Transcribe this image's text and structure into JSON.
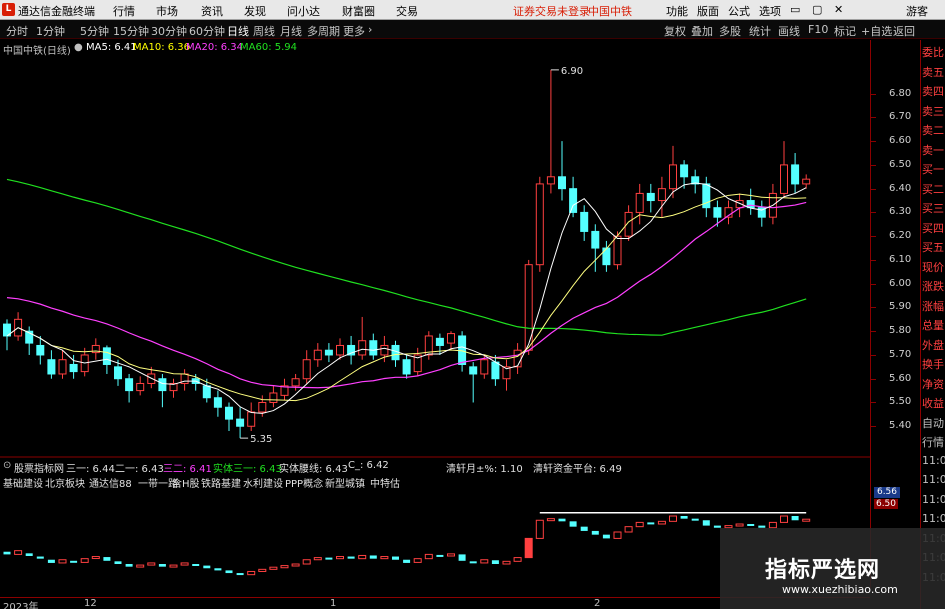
{
  "menubar": {
    "logo": "L",
    "app_title": "通达信金融终端",
    "items": [
      "行情",
      "市场",
      "资讯",
      "发现",
      "问小达",
      "财富圈",
      "交易"
    ],
    "status_text": "证券交易未登录",
    "stock_tag": "中国中铁",
    "right_items": [
      "功能",
      "版面",
      "公式",
      "选项"
    ],
    "guest": "游客"
  },
  "toolbar": {
    "periods": [
      "分时",
      "1分钟",
      "5分钟",
      "15分钟",
      "30分钟",
      "60分钟",
      "日线",
      "周线",
      "月线",
      "多周期",
      "更多"
    ],
    "right_items": [
      "复权",
      "叠加",
      "多股",
      "统计",
      "画线",
      "F10",
      "标记",
      "+自选",
      "返回"
    ]
  },
  "chart_info": {
    "title": "中国中铁(日线)",
    "ma5": "MA5: 6.41",
    "ma10": "MA10: 6.36",
    "ma20": "MA20: 6.34",
    "ma60": "MA60: 5.94"
  },
  "annotations": {
    "high": "6.90",
    "low": "5.35"
  },
  "sub_info": {
    "name": "股票指标网",
    "items": [
      {
        "text": "三一: 6.44",
        "color": "#e0e0e0"
      },
      {
        "text": "二一: 6.43",
        "color": "#e0e0e0"
      },
      {
        "text": "三二: 6.41",
        "color": "#ff40ff"
      },
      {
        "text": "实体三一: 6.43",
        "color": "#20e020"
      },
      {
        "text": "实体腰线: 6.43",
        "color": "#e0e0e0"
      },
      {
        "text": "C_: 6.42",
        "color": "#e0e0e0"
      },
      {
        "text": "清轩月±%: 1.10",
        "color": "#e0e0e0"
      },
      {
        "text": "清轩资金平台: 6.49",
        "color": "#e0e0e0"
      }
    ]
  },
  "sector_labels": [
    "基础建设",
    "北京板块",
    "通达信88",
    "一带一路",
    "含H股",
    "铁路基建",
    "水利建设",
    "PPP概念",
    "新型城镇",
    "中特估"
  ],
  "price_axis": [
    "6.80",
    "6.70",
    "6.60",
    "6.50",
    "6.40",
    "6.30",
    "6.20",
    "6.10",
    "6.00",
    "5.90",
    "5.80",
    "5.70",
    "5.60",
    "5.50",
    "5.40"
  ],
  "sub_axis": {
    "current": "6.56",
    "current2": "6.50"
  },
  "right_panel": [
    "委比",
    "卖五",
    "卖四",
    "卖三",
    "卖二",
    "卖一",
    "买一",
    "买二",
    "买三",
    "买四",
    "买五",
    "现价",
    "涨跌",
    "涨幅",
    "总量",
    "外盘",
    "换手",
    "净资",
    "收益",
    "自动",
    "行情",
    "11:0",
    "11:0",
    "11:0",
    "11:0",
    "11:0",
    "11:0",
    "11:0"
  ],
  "bottom_dates": [
    "2023年",
    "12",
    "1",
    "2"
  ],
  "watermark": {
    "title": "指标严选网",
    "url": "www.xuezhibiao.com"
  },
  "colors": {
    "up": "#ff4040",
    "down": "#54ffff",
    "ma5": "#ffffff",
    "ma10": "#ffff00",
    "ma20": "#ff40ff",
    "ma60": "#20e020"
  },
  "chart_data": {
    "type": "candlestick",
    "title": "中国中铁(日线)",
    "ylim": [
      5.3,
      6.95
    ],
    "candles": [
      [
        5.83,
        5.78,
        5.85,
        5.72
      ],
      [
        5.78,
        5.85,
        5.88,
        5.76
      ],
      [
        5.8,
        5.75,
        5.82,
        5.7
      ],
      [
        5.74,
        5.7,
        5.78,
        5.66
      ],
      [
        5.68,
        5.62,
        5.72,
        5.6
      ],
      [
        5.62,
        5.68,
        5.72,
        5.6
      ],
      [
        5.66,
        5.63,
        5.7,
        5.6
      ],
      [
        5.63,
        5.7,
        5.73,
        5.61
      ],
      [
        5.71,
        5.74,
        5.77,
        5.68
      ],
      [
        5.73,
        5.66,
        5.74,
        5.62
      ],
      [
        5.65,
        5.6,
        5.68,
        5.57
      ],
      [
        5.6,
        5.55,
        5.62,
        5.5
      ],
      [
        5.55,
        5.58,
        5.61,
        5.53
      ],
      [
        5.58,
        5.62,
        5.65,
        5.56
      ],
      [
        5.6,
        5.55,
        5.62,
        5.48
      ],
      [
        5.55,
        5.58,
        5.6,
        5.52
      ],
      [
        5.58,
        5.62,
        5.64,
        5.55
      ],
      [
        5.6,
        5.58,
        5.62,
        5.55
      ],
      [
        5.57,
        5.52,
        5.6,
        5.5
      ],
      [
        5.52,
        5.48,
        5.55,
        5.44
      ],
      [
        5.48,
        5.43,
        5.5,
        5.38
      ],
      [
        5.43,
        5.4,
        5.48,
        5.35
      ],
      [
        5.4,
        5.46,
        5.5,
        5.38
      ],
      [
        5.46,
        5.5,
        5.53,
        5.44
      ],
      [
        5.5,
        5.54,
        5.57,
        5.48
      ],
      [
        5.53,
        5.57,
        5.6,
        5.51
      ],
      [
        5.57,
        5.6,
        5.62,
        5.55
      ],
      [
        5.6,
        5.68,
        5.72,
        5.58
      ],
      [
        5.68,
        5.72,
        5.75,
        5.65
      ],
      [
        5.72,
        5.7,
        5.75,
        5.67
      ],
      [
        5.7,
        5.74,
        5.77,
        5.68
      ],
      [
        5.74,
        5.7,
        5.78,
        5.66
      ],
      [
        5.7,
        5.76,
        5.86,
        5.68
      ],
      [
        5.76,
        5.7,
        5.79,
        5.68
      ],
      [
        5.7,
        5.74,
        5.78,
        5.67
      ],
      [
        5.74,
        5.68,
        5.76,
        5.65
      ],
      [
        5.68,
        5.62,
        5.7,
        5.6
      ],
      [
        5.63,
        5.7,
        5.73,
        5.61
      ],
      [
        5.7,
        5.78,
        5.8,
        5.68
      ],
      [
        5.77,
        5.74,
        5.79,
        5.7
      ],
      [
        5.75,
        5.79,
        5.8,
        5.72
      ],
      [
        5.78,
        5.66,
        5.8,
        5.63
      ],
      [
        5.65,
        5.62,
        5.67,
        5.5
      ],
      [
        5.62,
        5.68,
        5.7,
        5.6
      ],
      [
        5.67,
        5.6,
        5.7,
        5.57
      ],
      [
        5.6,
        5.65,
        5.68,
        5.55
      ],
      [
        5.65,
        5.72,
        5.75,
        5.62
      ],
      [
        5.72,
        6.08,
        6.1,
        5.7
      ],
      [
        6.08,
        6.42,
        6.45,
        6.05
      ],
      [
        6.42,
        6.45,
        6.9,
        6.38
      ],
      [
        6.45,
        6.4,
        6.6,
        6.35
      ],
      [
        6.4,
        6.3,
        6.45,
        6.28
      ],
      [
        6.3,
        6.22,
        6.33,
        6.18
      ],
      [
        6.22,
        6.15,
        6.25,
        6.05
      ],
      [
        6.15,
        6.08,
        6.18,
        6.05
      ],
      [
        6.08,
        6.2,
        6.22,
        6.06
      ],
      [
        6.2,
        6.3,
        6.33,
        6.18
      ],
      [
        6.3,
        6.38,
        6.42,
        6.25
      ],
      [
        6.38,
        6.35,
        6.42,
        6.3
      ],
      [
        6.35,
        6.4,
        6.45,
        6.28
      ],
      [
        6.4,
        6.5,
        6.58,
        6.36
      ],
      [
        6.5,
        6.45,
        6.52,
        6.4
      ],
      [
        6.45,
        6.42,
        6.48,
        6.38
      ],
      [
        6.42,
        6.32,
        6.45,
        6.28
      ],
      [
        6.32,
        6.28,
        6.35,
        6.24
      ],
      [
        6.28,
        6.32,
        6.35,
        6.25
      ],
      [
        6.32,
        6.35,
        6.38,
        6.28
      ],
      [
        6.35,
        6.32,
        6.4,
        6.29
      ],
      [
        6.32,
        6.28,
        6.35,
        6.24
      ],
      [
        6.28,
        6.38,
        6.42,
        6.25
      ],
      [
        6.38,
        6.5,
        6.6,
        6.36
      ],
      [
        6.5,
        6.42,
        6.55,
        6.38
      ],
      [
        6.42,
        6.44,
        6.46,
        6.4
      ]
    ]
  }
}
